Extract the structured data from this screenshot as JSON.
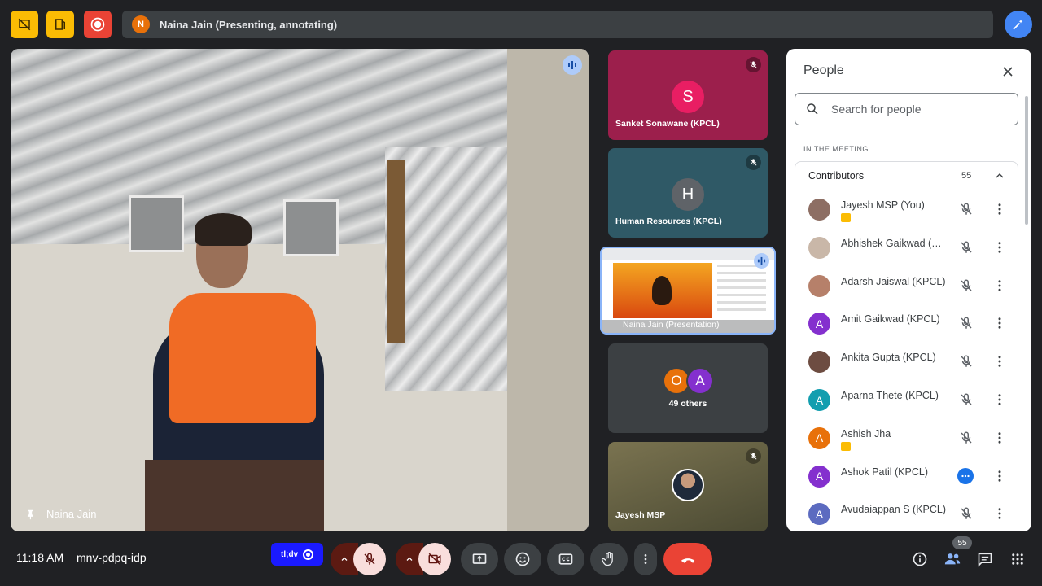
{
  "top_bar": {
    "presenter_initial": "N",
    "presenter_text": "Naina Jain (Presenting, annotating)",
    "icons": [
      "no-slides-icon",
      "activities-icon",
      "record-icon",
      "annotate-icon"
    ]
  },
  "main_video": {
    "name": "Naina Jain",
    "pinned": true,
    "speaking": true
  },
  "tiles": [
    {
      "name": "Sanket Sonawane (KPCL)",
      "initial": "S",
      "bg": "#9c1f4c",
      "avatar_color": "#e91e63",
      "muted": true
    },
    {
      "name": "Human Resources (KPCL)",
      "initial": "H",
      "bg": "#2f5966",
      "avatar_color": "#5f6368",
      "muted": true
    },
    {
      "name": "Naina Jain (Presentation)",
      "speaking": true
    },
    {
      "others_label": "49 others",
      "initials": [
        "O",
        "A"
      ],
      "colors": [
        "#e8710a",
        "#8430ce"
      ]
    },
    {
      "name": "Jayesh MSP",
      "muted": true
    }
  ],
  "people_panel": {
    "title": "People",
    "search_placeholder": "Search for people",
    "section_label": "IN THE MEETING",
    "group_name": "Contributors",
    "group_count": "55",
    "people": [
      {
        "name": "Jayesh MSP (You)",
        "initial": "",
        "color": "#8d6e63",
        "badge": true,
        "status": "muted"
      },
      {
        "name": "Abhishek Gaikwad (KPCL)",
        "initial": "",
        "color": "#c9b7a8",
        "badge": false,
        "status": "muted"
      },
      {
        "name": "Adarsh Jaiswal (KPCL)",
        "initial": "",
        "color": "#b6806a",
        "badge": false,
        "status": "muted"
      },
      {
        "name": "Amit Gaikwad (KPCL)",
        "initial": "A",
        "color": "#8430ce",
        "badge": false,
        "status": "muted"
      },
      {
        "name": "Ankita Gupta (KPCL)",
        "initial": "",
        "color": "#6d4c41",
        "badge": false,
        "status": "muted"
      },
      {
        "name": "Aparna Thete (KPCL)",
        "initial": "A",
        "color": "#129eaf",
        "badge": false,
        "status": "muted"
      },
      {
        "name": "Ashish Jha",
        "initial": "A",
        "color": "#e8710a",
        "badge": true,
        "status": "muted"
      },
      {
        "name": "Ashok Patil (KPCL)",
        "initial": "A",
        "color": "#8430ce",
        "badge": false,
        "status": "more"
      },
      {
        "name": "Avudaiappan S (KPCL)",
        "initial": "A",
        "color": "#5c6bc0",
        "badge": false,
        "status": "muted"
      }
    ]
  },
  "bottom_bar": {
    "time": "11:18 AM",
    "meeting_code": "mnv-pdpq-idp",
    "cc_label": "tl;dv",
    "people_badge": "55"
  }
}
